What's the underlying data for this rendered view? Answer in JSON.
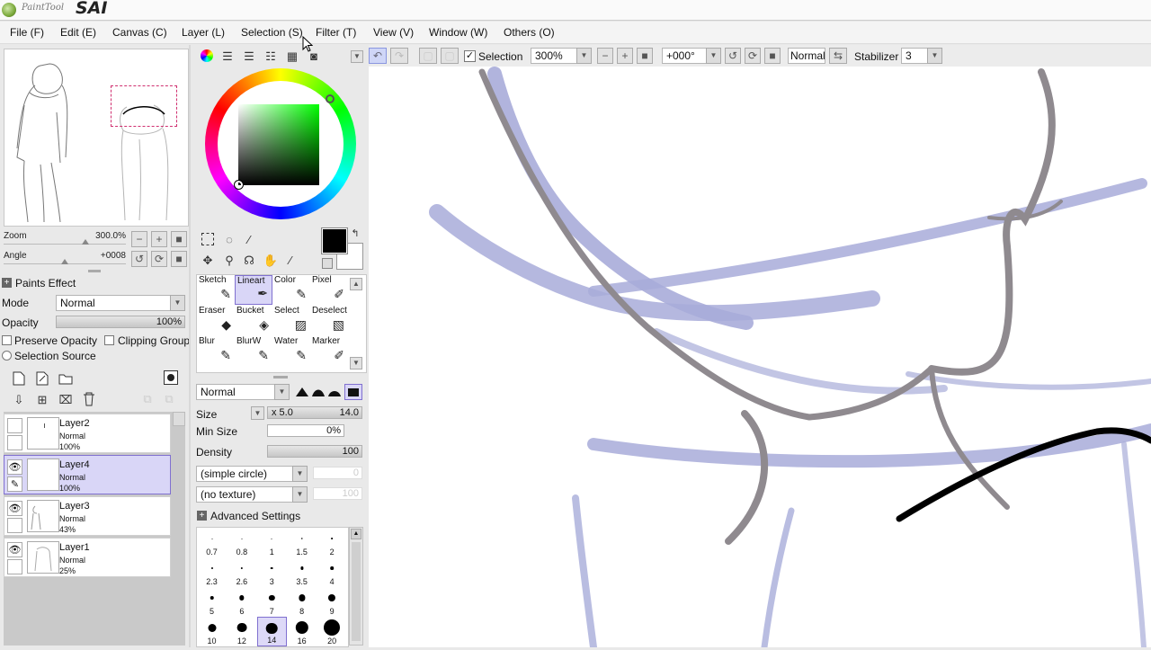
{
  "app": {
    "logo_small": "PaintTool",
    "logo_big": "SAI"
  },
  "menu": [
    "File (F)",
    "Edit (E)",
    "Canvas (C)",
    "Layer (L)",
    "Selection (S)",
    "Filter (T)",
    "View (V)",
    "Window (W)",
    "Others (O)"
  ],
  "toolbar": {
    "selection_label": "Selection",
    "zoom_value": "300%",
    "angle_value": "+000°",
    "mode_value": "Normal",
    "stabilizer_label": "Stabilizer",
    "stabilizer_value": "3"
  },
  "navigator": {
    "zoom_label": "Zoom",
    "zoom_value": "300.0%",
    "zoom_level_fraction": 0.67,
    "angle_label": "Angle",
    "angle_value": "+0008",
    "angle_level_fraction": 0.5
  },
  "paint_effect": {
    "header": "Paints Effect",
    "mode_label": "Mode",
    "mode_value": "Normal",
    "opacity_label": "Opacity",
    "opacity_value": "100%",
    "preserve_opacity": "Preserve Opacity",
    "clipping_group": "Clipping Group",
    "selection_source": "Selection Source"
  },
  "layers": [
    {
      "name": "Layer2",
      "mode": "Normal",
      "opacity": "100%",
      "visible": false,
      "selected": false
    },
    {
      "name": "Layer4",
      "mode": "Normal",
      "opacity": "100%",
      "visible": true,
      "selected": true
    },
    {
      "name": "Layer3",
      "mode": "Normal",
      "opacity": "43%",
      "visible": true,
      "selected": false
    },
    {
      "name": "Layer1",
      "mode": "Normal",
      "opacity": "25%",
      "visible": true,
      "selected": false
    }
  ],
  "tools": [
    "Sketch",
    "Lineart",
    "Color",
    "Pixel",
    "Eraser",
    "Bucket",
    "Select",
    "Deselect",
    "Blur",
    "BlurW",
    "Water",
    "Marker"
  ],
  "selected_tool": "Lineart",
  "brush": {
    "blend_mode": "Normal",
    "size_label": "Size",
    "size_multiplier": "x 5.0",
    "size_value": "14.0",
    "min_size_label": "Min Size",
    "min_size_value": "0%",
    "density_label": "Density",
    "density_value": "100",
    "shape": "(simple circle)",
    "shape_value": "0",
    "texture": "(no texture)",
    "texture_value": "100",
    "advanced": "Advanced Settings"
  },
  "brush_sizes": [
    "0.7",
    "0.8",
    "1",
    "1.5",
    "2",
    "2.3",
    "2.6",
    "3",
    "3.5",
    "4",
    "5",
    "6",
    "7",
    "8",
    "9",
    "10",
    "12",
    "14",
    "16",
    "20"
  ],
  "selected_brush_size": "14",
  "colors": {
    "accent": "#8070d0",
    "selection_fill": "#d9d6f7",
    "primary": "#000000",
    "stroke_blue": "#a8acd9",
    "stroke_gray": "#8f8a8f"
  }
}
